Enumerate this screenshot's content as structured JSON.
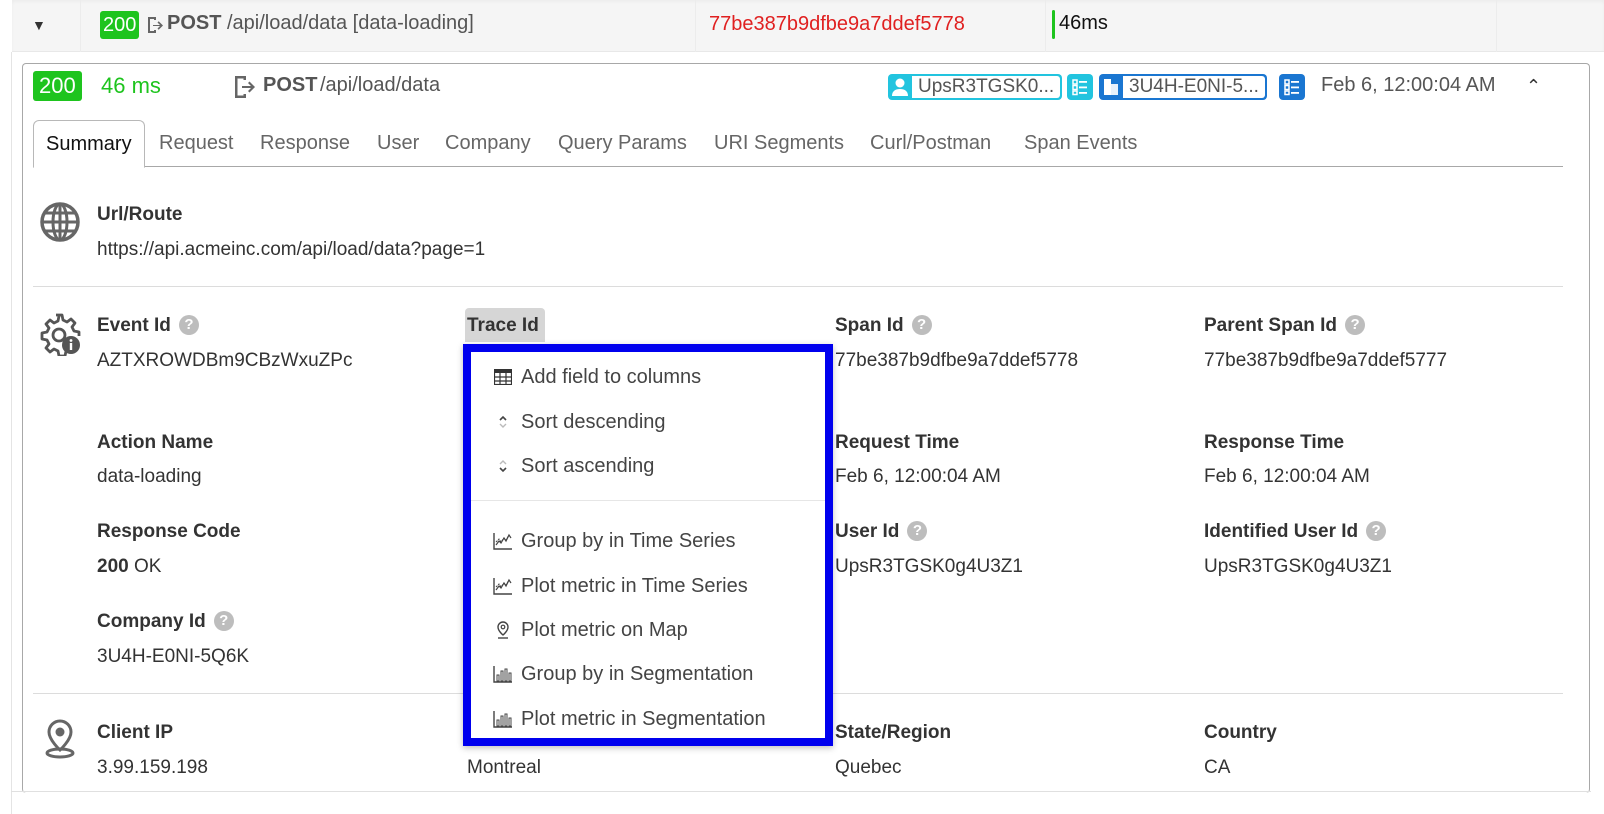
{
  "top_row": {
    "status_code": "200",
    "method": "POST",
    "path": "/api/load/data [data-loading]",
    "span_id": "77be387b9dfbe9a7ddef5778",
    "duration": "46ms"
  },
  "header": {
    "status_code": "200",
    "duration": "46 ms",
    "method": "POST",
    "path": "/api/load/data",
    "user_chip": "UpsR3TGSK0...",
    "company_chip": "3U4H-E0NI-5...",
    "date": "Feb 6, 12:00:04 AM"
  },
  "tabs": [
    {
      "label": "Summary",
      "active": true
    },
    {
      "label": "Request"
    },
    {
      "label": "Response"
    },
    {
      "label": "User"
    },
    {
      "label": "Company"
    },
    {
      "label": "Query Params"
    },
    {
      "label": "URI Segments"
    },
    {
      "label": "Curl/Postman"
    },
    {
      "label": "Span Events"
    }
  ],
  "url_section": {
    "label": "Url/Route",
    "value": "https://api.acmeinc.com/api/load/data?page=1"
  },
  "event_section": {
    "event_id": {
      "label": "Event Id",
      "value": "AZTXROWDBm9CBzWxuZPc"
    },
    "trace_id": {
      "label": "Trace Id"
    },
    "span_id": {
      "label": "Span Id",
      "value": "77be387b9dfbe9a7ddef5778"
    },
    "parent_span_id": {
      "label": "Parent Span Id",
      "value": "77be387b9dfbe9a7ddef5777"
    },
    "action_name": {
      "label": "Action Name",
      "value": "data-loading"
    },
    "request_time": {
      "label": "Request Time",
      "value": "Feb 6, 12:00:04 AM"
    },
    "response_time": {
      "label": "Response Time",
      "value": "Feb 6, 12:00:04 AM"
    },
    "response_code": {
      "label": "Response Code",
      "code": "200",
      "text": "OK"
    },
    "user_id": {
      "label": "User Id",
      "value": "UpsR3TGSK0g4U3Z1"
    },
    "identified_user_id": {
      "label": "Identified User Id",
      "value": "UpsR3TGSK0g4U3Z1"
    },
    "company_id": {
      "label": "Company Id",
      "value": "3U4H-E0NI-5Q6K"
    }
  },
  "location_section": {
    "client_ip": {
      "label": "Client IP",
      "value": "3.99.159.198"
    },
    "city": {
      "value": "Montreal"
    },
    "state": {
      "label": "State/Region",
      "value": "Quebec"
    },
    "country": {
      "label": "Country",
      "value": "CA"
    }
  },
  "context_menu": {
    "items": [
      {
        "label": "Add field to columns",
        "icon": "table-icon"
      },
      {
        "label": "Sort descending",
        "icon": "sort-desc-icon"
      },
      {
        "label": "Sort ascending",
        "icon": "sort-asc-icon"
      },
      {
        "label": "Group by in Time Series",
        "icon": "time-series-icon"
      },
      {
        "label": "Plot metric in Time Series",
        "icon": "time-series-icon"
      },
      {
        "label": "Plot metric on Map",
        "icon": "map-pin-icon"
      },
      {
        "label": "Group by in Segmentation",
        "icon": "bar-chart-icon"
      },
      {
        "label": "Plot metric in Segmentation",
        "icon": "bar-chart-icon"
      }
    ]
  },
  "colors": {
    "success": "#1ec41e",
    "span_id_red": "#e02020",
    "user_chip": "#22c4df",
    "company_chip": "#1a76d1",
    "menu_highlight_border": "#0000ee"
  }
}
